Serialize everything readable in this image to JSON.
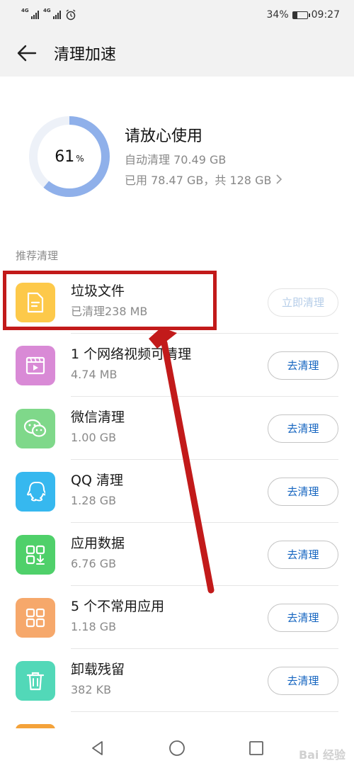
{
  "status_bar": {
    "signal1_tag": "4G",
    "signal2_tag": "4G",
    "battery": "34%",
    "battery_level": 0.34,
    "time": "09:27"
  },
  "app_bar": {
    "title": "清理加速",
    "back_icon": "arrow-left-icon"
  },
  "summary": {
    "percent_value": "61",
    "percent_unit": "%",
    "percent_fraction": 0.61,
    "ring_color": "#8fb0ea",
    "ring_track_color": "#edf1f8",
    "title": "请放心使用",
    "auto_clean": "自动清理 70.49 GB",
    "usage": "已用 78.47 GB，共 128 GB"
  },
  "section_label": "推荐清理",
  "items": [
    {
      "title": "垃圾文件",
      "subtitle": "已清理238 MB",
      "button": "立即清理",
      "icon": "document-icon",
      "color": "#fdc94a"
    },
    {
      "title": "1 个网络视频可清理",
      "subtitle": "4.74 MB",
      "button": "去清理",
      "icon": "video-icon",
      "color": "#d98ad6"
    },
    {
      "title": "微信清理",
      "subtitle": "1.00 GB",
      "button": "去清理",
      "icon": "wechat-icon",
      "color": "#7fd88a"
    },
    {
      "title": "QQ 清理",
      "subtitle": "1.28 GB",
      "button": "去清理",
      "icon": "qq-icon",
      "color": "#36b8ef"
    },
    {
      "title": "应用数据",
      "subtitle": "6.76 GB",
      "button": "去清理",
      "icon": "app-data-icon",
      "color": "#4fd06a"
    },
    {
      "title": "5 个不常用应用",
      "subtitle": "1.18 GB",
      "button": "去清理",
      "icon": "apps-grid-icon",
      "color": "#f6a86b"
    },
    {
      "title": "卸载残留",
      "subtitle": "382 KB",
      "button": "去清理",
      "icon": "trash-icon",
      "color": "#52d8b8"
    }
  ],
  "colors": {
    "accent": "#1565c0",
    "annotation_red": "#c21a1a"
  },
  "watermark": "Bai 经验"
}
